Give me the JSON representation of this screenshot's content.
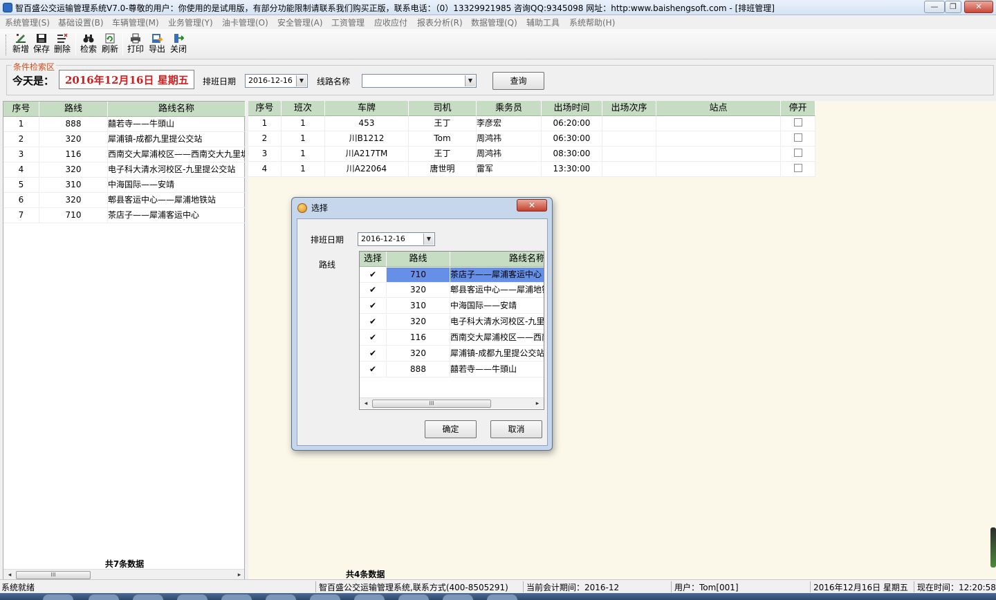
{
  "window": {
    "title": "智百盛公交运输管理系统V7.0-尊敬的用户：你使用的是试用版，有部分功能限制请联系我们购买正版，联系电话：（0）13329921985 咨询QQ:9345098 网址：http:www.baishengsoft.com - [排班管理]",
    "minimize": "—",
    "maximize": "❐",
    "close": "✕"
  },
  "menu": [
    "系统管理(S)",
    "基础设置(B)",
    "车辆管理(M)",
    "业务管理(Y)",
    "油卡管理(O)",
    "安全管理(A)",
    "工资管理",
    "应收应付",
    "报表分析(R)",
    "数据管理(Q)",
    "辅助工具",
    "系统帮助(H)"
  ],
  "toolbar": {
    "add": "新增",
    "save": "保存",
    "delete": "删除",
    "search": "检索",
    "refresh": "刷新",
    "print": "打印",
    "export": "导出",
    "close": "关闭"
  },
  "search": {
    "legend": "条件检索区",
    "today_label": "今天是：",
    "today_value": "2016年12月16日  星期五",
    "date_label": "排班日期",
    "date_value": "2016-12-16",
    "route_label": "线路名称",
    "route_value": "",
    "query_button": "查询"
  },
  "left_grid": {
    "columns": [
      "序号",
      "路线",
      "路线名称"
    ],
    "rows": [
      [
        "1",
        "888",
        "囍若寺——牛頭山"
      ],
      [
        "2",
        "320",
        "犀浦镇-成都九里提公交站"
      ],
      [
        "3",
        "116",
        "西南交大犀浦校区——西南交大九里堤"
      ],
      [
        "4",
        "320",
        "电子科大清水河校区-九里提公交站"
      ],
      [
        "5",
        "310",
        "中海国际——安靖"
      ],
      [
        "6",
        "320",
        "郫县客运中心——犀浦地铁站"
      ],
      [
        "7",
        "710",
        "茶店子——犀浦客运中心"
      ]
    ],
    "footer": "共7条数据"
  },
  "right_grid": {
    "columns": [
      "序号",
      "班次",
      "车牌",
      "司机",
      "乘务员",
      "出场时间",
      "出场次序",
      "站点",
      "停开"
    ],
    "rows": [
      [
        "1",
        "1",
        "453",
        "王丁",
        "李彦宏",
        "06:20:00",
        "",
        "",
        ""
      ],
      [
        "2",
        "1",
        "川B1212",
        "Tom",
        "周鸿祎",
        "06:30:00",
        "",
        "",
        ""
      ],
      [
        "3",
        "1",
        "川A217TM",
        "王丁",
        "周鸿祎",
        "08:30:00",
        "",
        "",
        ""
      ],
      [
        "4",
        "1",
        "川A22064",
        "唐世明",
        "雷军",
        "13:30:00",
        "",
        "",
        ""
      ]
    ],
    "footer": "共4条数据"
  },
  "dialog": {
    "title": "选择",
    "close": "✕",
    "date_label": "排班日期",
    "date_value": "2016-12-16",
    "route_label": "路线",
    "columns": [
      "选择",
      "路线",
      "路线名称"
    ],
    "rows": [
      [
        "✔",
        "710",
        "茶店子——犀浦客运中心"
      ],
      [
        "✔",
        "320",
        "郫县客运中心——犀浦地铁站"
      ],
      [
        "✔",
        "310",
        "中海国际——安靖"
      ],
      [
        "✔",
        "320",
        "电子科大清水河校区-九里提公交站"
      ],
      [
        "✔",
        "116",
        "西南交大犀浦校区——西南交大九里堤"
      ],
      [
        "✔",
        "320",
        "犀浦镇-成都九里提公交站"
      ],
      [
        "✔",
        "888",
        "囍若寺——牛頭山"
      ]
    ],
    "scroll_grip": "III",
    "ok": "确定",
    "cancel": "取消"
  },
  "scroll": {
    "left": "◂",
    "right": "▸",
    "grip": "III"
  },
  "status": {
    "ready": "系统就绪",
    "company": "智百盛公交运输管理系统,联系方式(400-8505291)",
    "period": "当前会计期间：2016-12",
    "user": "用户：Tom[001]",
    "date": "2016年12月16日  星期五",
    "time": "现在时间：12:20:58"
  },
  "colors": {
    "grid_header": "#c6dcc3",
    "selected_row": "#6690e8",
    "right_background": "#fbf8ea",
    "today_text": "#d31d1d",
    "legend_text": "#d04e1c"
  }
}
